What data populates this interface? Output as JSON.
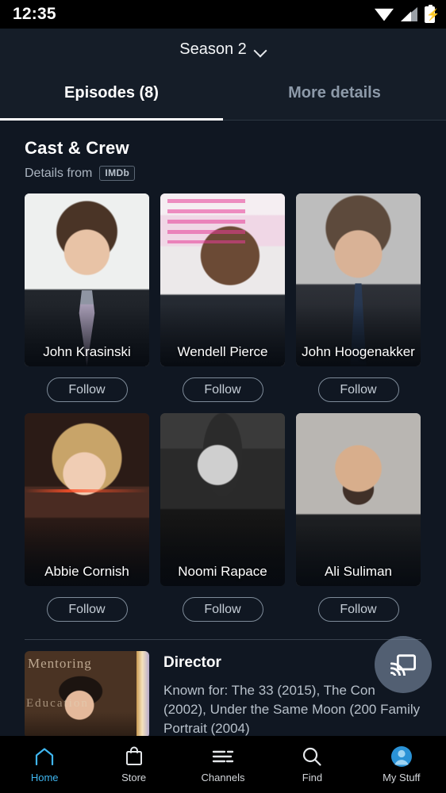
{
  "status_bar": {
    "time": "12:35",
    "icons": [
      "wifi-icon",
      "cellular-signal-icon",
      "battery-charging-icon"
    ]
  },
  "header": {
    "season_label": "Season 2",
    "chevron": "chevron-down-icon"
  },
  "tabs": [
    {
      "label": "Episodes (8)",
      "active": true
    },
    {
      "label": "More details",
      "active": false
    }
  ],
  "cast_section": {
    "title": "Cast & Crew",
    "details_from_label": "Details from",
    "source_badge": "IMDb",
    "follow_label": "Follow",
    "members": [
      {
        "name": "John Krasinski",
        "art": "ph-krasinski"
      },
      {
        "name": "Wendell Pierce",
        "art": "ph-pierce"
      },
      {
        "name": "John Hoogenakker",
        "art": "ph-hoogenakker"
      },
      {
        "name": "Abbie Cornish",
        "art": "ph-cornish"
      },
      {
        "name": "Noomi Rapace",
        "art": "ph-rapace"
      },
      {
        "name": "Ali Suliman",
        "art": "ph-suliman"
      }
    ]
  },
  "director_section": {
    "label": "Director",
    "known_for": "Known for: The 33 (2015), The Con (2002), Under the Same Moon (200 Family Portrait (2004)",
    "thumb_word1": "Mentoring",
    "thumb_word2": "Education"
  },
  "cast_button": {
    "icon": "chromecast-icon"
  },
  "bottom_nav": [
    {
      "label": "Home",
      "icon": "home-icon",
      "active": true
    },
    {
      "label": "Store",
      "icon": "shopping-bag-icon",
      "active": false
    },
    {
      "label": "Channels",
      "icon": "channels-list-icon",
      "active": false
    },
    {
      "label": "Find",
      "icon": "search-icon",
      "active": false
    },
    {
      "label": "My Stuff",
      "icon": "account-avatar-icon",
      "active": false
    }
  ],
  "colors": {
    "background": "#101722",
    "header_background": "#151d28",
    "accent": "#3fb6f0",
    "active_tab": "#ffffff",
    "inactive_tab": "#8d9aa9",
    "secondary_text": "#b7c0ca"
  }
}
